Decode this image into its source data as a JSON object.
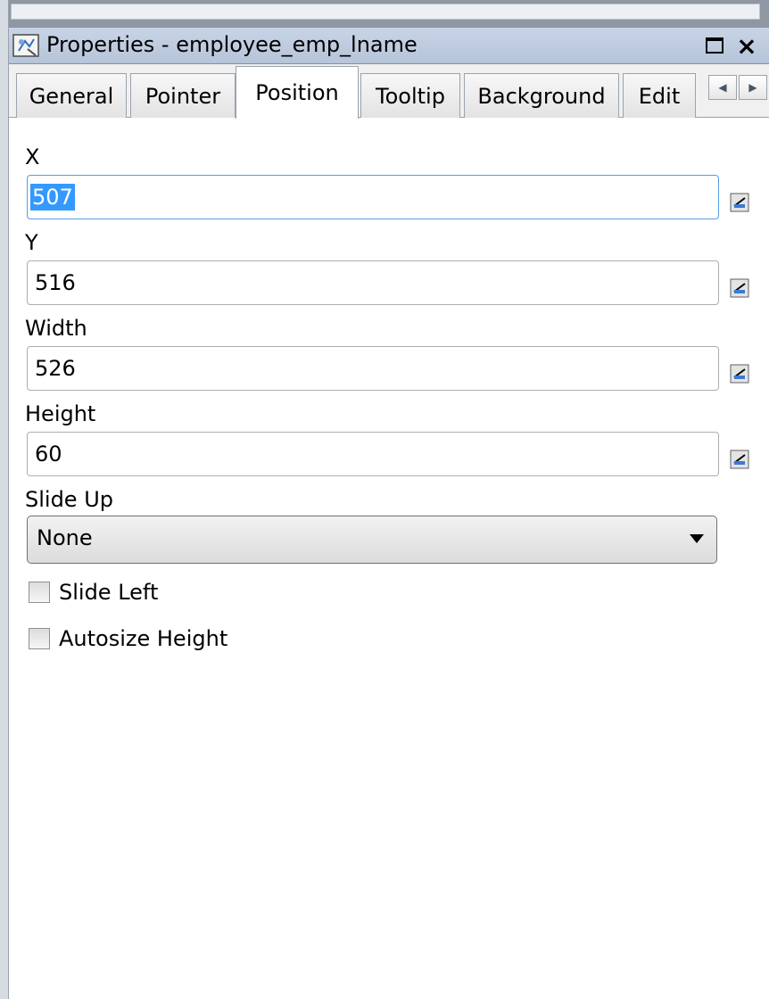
{
  "window": {
    "title": "Properties - employee_emp_lname",
    "restore_label": "",
    "close_label": "×"
  },
  "tabs": [
    {
      "label": "General"
    },
    {
      "label": "Pointer"
    },
    {
      "label": "Position"
    },
    {
      "label": "Tooltip"
    },
    {
      "label": "Background"
    },
    {
      "label": "Edit"
    }
  ],
  "active_tab": "Position",
  "fields": {
    "x": {
      "label": "X",
      "value": "507"
    },
    "y": {
      "label": "Y",
      "value": "516"
    },
    "width": {
      "label": "Width",
      "value": "526"
    },
    "height": {
      "label": "Height",
      "value": "60"
    }
  },
  "slide_up": {
    "label": "Slide Up",
    "selected": "None"
  },
  "checkboxes": {
    "slide_left": {
      "label": "Slide Left",
      "checked": false
    },
    "autosize_height": {
      "label": "Autosize Height",
      "checked": false
    }
  },
  "colors": {
    "selection": "#3399ff",
    "focus_border": "#569de5",
    "title_bar": "#c8d4e6"
  },
  "icons": {
    "window": "properties-icon",
    "expression": "expression-button-icon"
  }
}
